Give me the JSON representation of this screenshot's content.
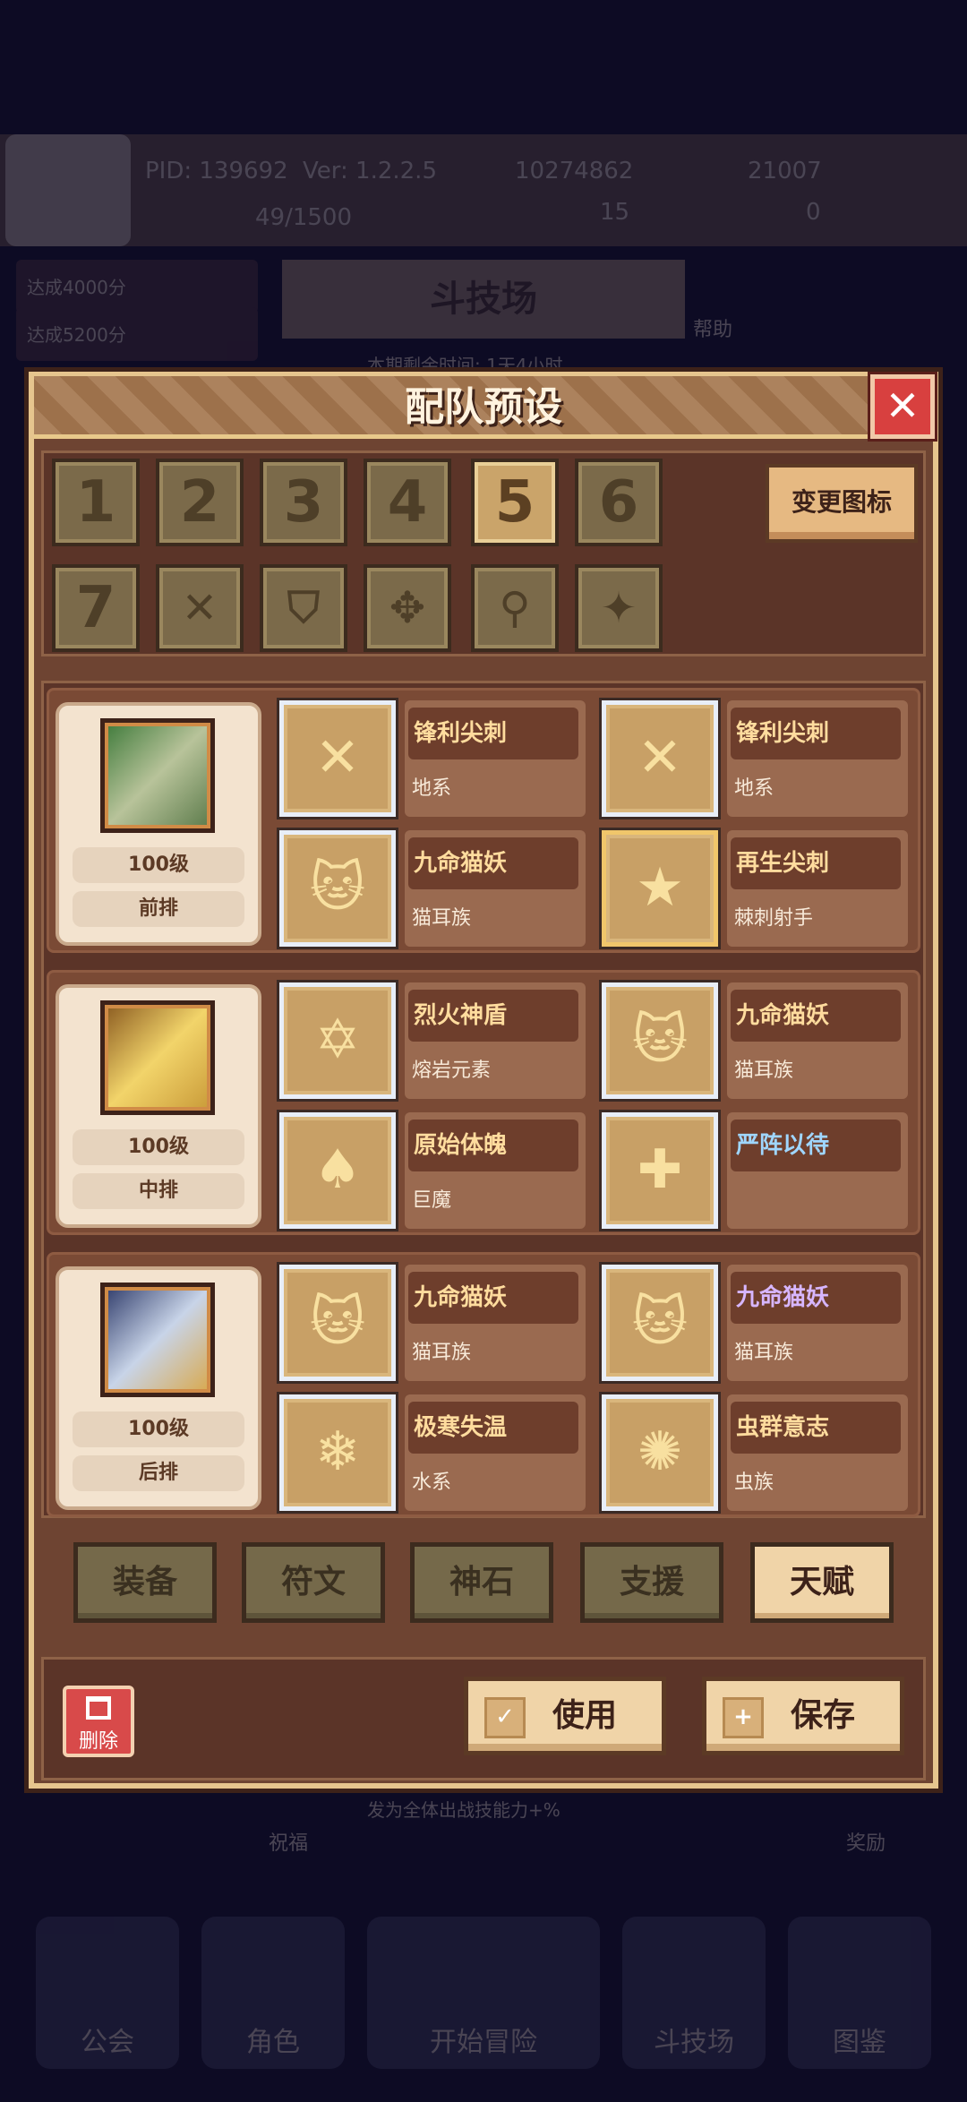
{
  "background": {
    "pid": "PID: 139692",
    "version": "Ver: 1.2.2.5",
    "gold": "10274862",
    "gems": "21007",
    "stamina": "49/1500",
    "clovers": "15",
    "keys": "0",
    "side_items": [
      "达成4000分",
      "达成5200分"
    ],
    "arena_title": "斗技场",
    "help_label": "帮助",
    "remaining_time": "本期剩余时间: 1天4小时",
    "reward_desc": "发为全体出战技能力+%",
    "blessing_label": "祝福",
    "reward_label": "奖励",
    "nav": [
      "公会",
      "角色",
      "开始冒险",
      "斗技场",
      "图鉴"
    ]
  },
  "dialog": {
    "title": "配队预设",
    "close_symbol": "✕",
    "slots": [
      "1",
      "2",
      "3",
      "4",
      "5",
      "6"
    ],
    "icon_slots": [
      "7",
      "✕",
      "⛉",
      "✥",
      "⚲",
      "✦"
    ],
    "active_slot_index": 4,
    "change_icon_label": "变更图标",
    "rows": [
      {
        "level": "100级",
        "position": "前排",
        "skills": [
          {
            "name": "锋利尖刺",
            "type": "地系",
            "icon": "✕"
          },
          {
            "name": "锋利尖刺",
            "type": "地系",
            "icon": "✕"
          },
          {
            "name": "九命猫妖",
            "type": "猫耳族",
            "icon": "🐱"
          },
          {
            "name": "再生尖刺",
            "type": "棘刺射手",
            "icon": "★"
          }
        ]
      },
      {
        "level": "100级",
        "position": "中排",
        "skills": [
          {
            "name": "烈火神盾",
            "type": "熔岩元素",
            "icon": "✡"
          },
          {
            "name": "九命猫妖",
            "type": "猫耳族",
            "icon": "🐱"
          },
          {
            "name": "原始体魄",
            "type": "巨魔",
            "icon": "♠"
          },
          {
            "name": "严阵以待",
            "type": "",
            "icon": "✚"
          }
        ]
      },
      {
        "level": "100级",
        "position": "后排",
        "skills": [
          {
            "name": "九命猫妖",
            "type": "猫耳族",
            "icon": "🐱"
          },
          {
            "name": "九命猫妖",
            "type": "猫耳族",
            "icon": "🐱"
          },
          {
            "name": "极寒失温",
            "type": "水系",
            "icon": "❄"
          },
          {
            "name": "虫群意志",
            "type": "虫族",
            "icon": "✺"
          }
        ]
      }
    ],
    "tabs": [
      "装备",
      "符文",
      "神石",
      "支援",
      "天赋"
    ],
    "active_tab": "天赋",
    "delete_label": "删除",
    "use_label": "使用",
    "save_label": "保存",
    "use_icon": "✓",
    "save_icon": "+"
  },
  "colors": {
    "skill_name_default": "#ffdc9e",
    "skill_name_blue": "#9fd6ff",
    "skill_name_purple": "#d7b6ff"
  }
}
